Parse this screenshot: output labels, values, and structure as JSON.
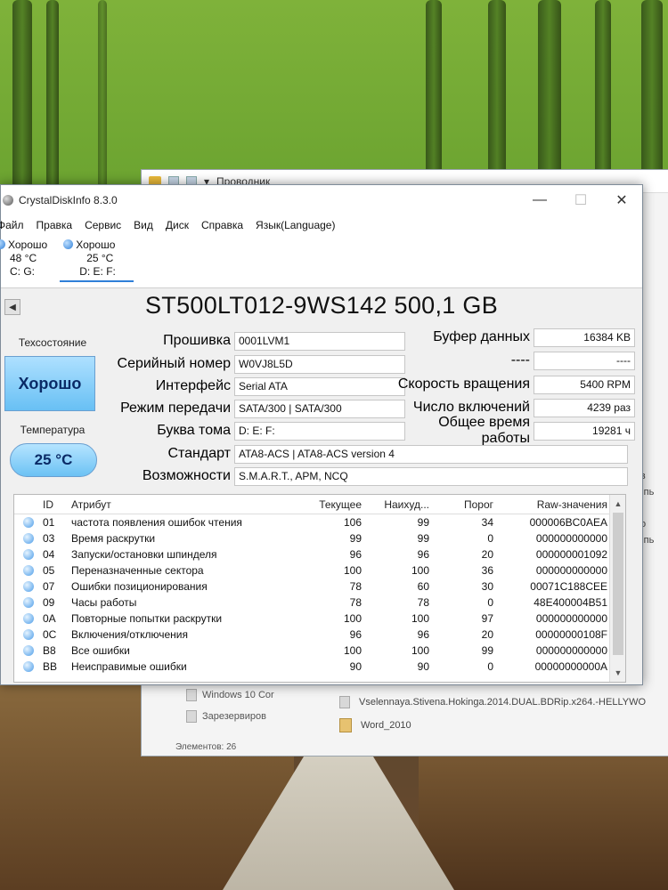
{
  "explorer": {
    "title": "Проводник",
    "side_items": [
      "зкв",
      "омпь",
      "зко",
      "омпь"
    ],
    "nav_items": [
      "Windows 10 Cor",
      "Зарезервиров"
    ],
    "files": [
      "Vselennaya.Stivena.Hokinga.2014.DUAL.BDRip.x264.-HELLYWO",
      "Word_2010"
    ],
    "status": "Элементов: 26"
  },
  "window": {
    "title": "CrystalDiskInfo 8.3.0",
    "minimize": "—",
    "maximize": "☐",
    "close": "✕"
  },
  "menu": [
    "Файл",
    "Правка",
    "Сервис",
    "Вид",
    "Диск",
    "Справка",
    "Язык(Language)"
  ],
  "drives": [
    {
      "status": "Хорошо",
      "temp": "48 °C",
      "letters": "C: G:"
    },
    {
      "status": "Хорошо",
      "temp": "25 °C",
      "letters": "D: E: F:"
    }
  ],
  "model": "ST500LT012-9WS142 500,1 GB",
  "prev_button": "◀",
  "health": {
    "label": "Техсостояние",
    "value": "Хорошо"
  },
  "temperature": {
    "label": "Температура",
    "value": "25 °C"
  },
  "fields_left": [
    {
      "key": "Прошивка",
      "value": "0001LVM1"
    },
    {
      "key": "Серийный номер",
      "value": "W0VJ8L5D"
    },
    {
      "key": "Интерфейс",
      "value": "Serial ATA"
    },
    {
      "key": "Режим передачи",
      "value": "SATA/300 | SATA/300"
    },
    {
      "key": "Буква тома",
      "value": "D: E: F:"
    }
  ],
  "fields_right": [
    {
      "key": "Буфер данных",
      "value": "16384 KB"
    },
    {
      "key": "----",
      "value": "----"
    },
    {
      "key": "Скорость вращения",
      "value": "5400 RPM"
    },
    {
      "key": "Число включений",
      "value": "4239 раз"
    },
    {
      "key": "Общее время работы",
      "value": "19281 ч"
    }
  ],
  "fields_wide": [
    {
      "key": "Стандарт",
      "value": "ATA8-ACS | ATA8-ACS version 4"
    },
    {
      "key": "Возможности",
      "value": "S.M.A.R.T., APM, NCQ"
    }
  ],
  "smart": {
    "headers": [
      "ID",
      "Атрибут",
      "Текущее",
      "Наихуд...",
      "Порог",
      "Raw-значения"
    ],
    "rows": [
      [
        "01",
        "частота появления ошибок чтения",
        "106",
        "99",
        "34",
        "000006BC0AEA"
      ],
      [
        "03",
        "Время раскрутки",
        "99",
        "99",
        "0",
        "000000000000"
      ],
      [
        "04",
        "Запуски/остановки шпинделя",
        "96",
        "96",
        "20",
        "000000001092"
      ],
      [
        "05",
        "Переназначенные сектора",
        "100",
        "100",
        "36",
        "000000000000"
      ],
      [
        "07",
        "Ошибки позиционирования",
        "78",
        "60",
        "30",
        "00071C188CEE"
      ],
      [
        "09",
        "Часы работы",
        "78",
        "78",
        "0",
        "48E400004B51"
      ],
      [
        "0A",
        "Повторные попытки раскрутки",
        "100",
        "100",
        "97",
        "000000000000"
      ],
      [
        "0C",
        "Включения/отключения",
        "96",
        "96",
        "20",
        "00000000108F"
      ],
      [
        "B8",
        "Все ошибки",
        "100",
        "100",
        "99",
        "000000000000"
      ],
      [
        "BB",
        "Неисправимые ошибки",
        "90",
        "90",
        "0",
        "00000000000A"
      ]
    ]
  }
}
